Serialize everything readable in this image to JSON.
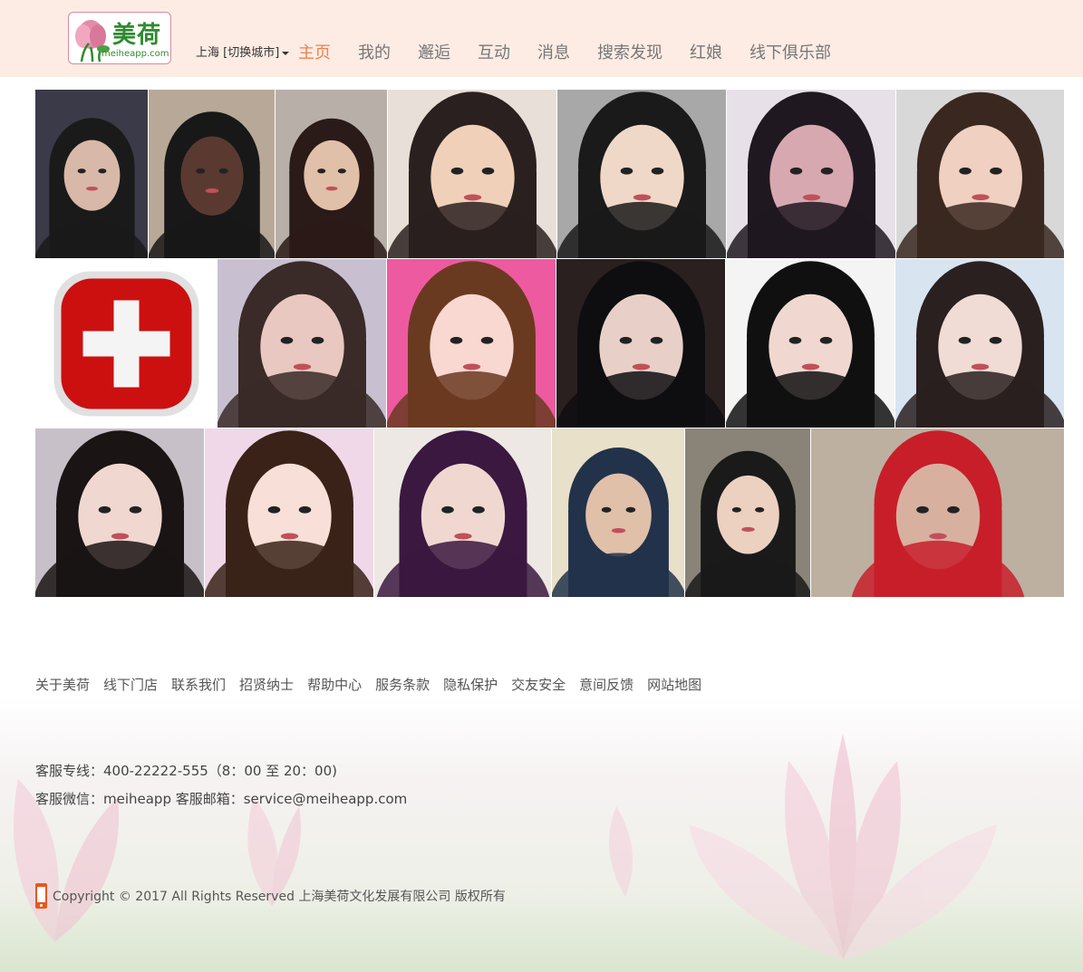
{
  "header": {
    "logo_cn": "美荷",
    "logo_en": "meiheapp.com",
    "city": "上海 [切换城市]",
    "nav": [
      {
        "label": "主页",
        "active": true
      },
      {
        "label": "我的",
        "active": false
      },
      {
        "label": "邂逅",
        "active": false
      },
      {
        "label": "互动",
        "active": false
      },
      {
        "label": "消息",
        "active": false
      },
      {
        "label": "搜索发现",
        "active": false
      },
      {
        "label": "红娘",
        "active": false
      },
      {
        "label": "线下俱乐部",
        "active": false
      }
    ],
    "accent_color": "#f08050",
    "background_color": "#fdece4"
  },
  "photos": [
    {
      "name": "profile-photo",
      "icon": "portrait",
      "palette": [
        "#3a3a48",
        "#d8b8a8",
        "#1a1a1a"
      ]
    },
    {
      "name": "profile-photo",
      "icon": "portrait",
      "palette": [
        "#b8a898",
        "#5a3a30",
        "#181818"
      ]
    },
    {
      "name": "profile-photo",
      "icon": "portrait",
      "palette": [
        "#b8b0a8",
        "#e0c0a8",
        "#2a1a18"
      ]
    },
    {
      "name": "profile-photo",
      "icon": "portrait",
      "palette": [
        "#e8e0d8",
        "#f0d0b8",
        "#2a2020"
      ]
    },
    {
      "name": "profile-photo",
      "icon": "portrait",
      "palette": [
        "#a8a8a8",
        "#f0d8c8",
        "#1a1a1a"
      ]
    },
    {
      "name": "profile-photo",
      "icon": "portrait",
      "palette": [
        "#e8e0e8",
        "#d8a8b0",
        "#201820"
      ]
    },
    {
      "name": "profile-photo",
      "icon": "portrait",
      "palette": [
        "#d8d8d8",
        "#f0d0c0",
        "#3a2820"
      ]
    },
    {
      "name": "red-cross-icon",
      "icon": "red-cross",
      "palette": [
        "#ffffff",
        "#cc1010",
        "#e0e0e0"
      ]
    },
    {
      "name": "profile-photo",
      "icon": "portrait",
      "palette": [
        "#c8c0d0",
        "#e8c8c0",
        "#3a2a28"
      ]
    },
    {
      "name": "profile-photo",
      "icon": "portrait",
      "palette": [
        "#ee5aa0",
        "#f8d8d0",
        "#6a3a20"
      ]
    },
    {
      "name": "profile-photo",
      "icon": "portrait",
      "palette": [
        "#2a2020",
        "#e8d0c8",
        "#0e0e10"
      ]
    },
    {
      "name": "profile-photo",
      "icon": "portrait",
      "palette": [
        "#f4f4f4",
        "#f0d8d0",
        "#101010"
      ]
    },
    {
      "name": "profile-photo",
      "icon": "portrait",
      "palette": [
        "#d8e4f0",
        "#f0dcd4",
        "#2a2020"
      ]
    },
    {
      "name": "profile-photo",
      "icon": "portrait",
      "palette": [
        "#c8c0c8",
        "#f0d8d0",
        "#1a1414"
      ]
    },
    {
      "name": "profile-photo",
      "icon": "portrait",
      "palette": [
        "#f0d8e8",
        "#f8e0d8",
        "#3a2218"
      ]
    },
    {
      "name": "profile-photo",
      "icon": "portrait",
      "palette": [
        "#eee8e4",
        "#f0d8d0",
        "#3a1840"
      ]
    },
    {
      "name": "profile-photo",
      "icon": "portrait",
      "palette": [
        "#e8e0c8",
        "#e0c0a8",
        "#22324a"
      ]
    },
    {
      "name": "profile-photo",
      "icon": "portrait",
      "palette": [
        "#8a8478",
        "#ecd0c0",
        "#1a1a1a"
      ]
    },
    {
      "name": "profile-photo",
      "icon": "portrait",
      "palette": [
        "#bdb0a0",
        "#d8b0a0",
        "#c81e2a"
      ]
    }
  ],
  "footer": {
    "links": [
      "关于美荷",
      "线下门店",
      "联系我们",
      "招贤纳士",
      "帮助中心",
      "服务条款",
      "隐私保护",
      "交友安全",
      "意间反馈",
      "网站地图"
    ],
    "hotline": "客服专线：400-22222-555（8：00 至 20：00)",
    "wechat": "客服微信：meiheapp 客服邮箱：service@meiheapp.com",
    "copyright": "Copyright © 2017 All Rights Reserved 上海美荷文化发展有限公司 版权所有"
  }
}
